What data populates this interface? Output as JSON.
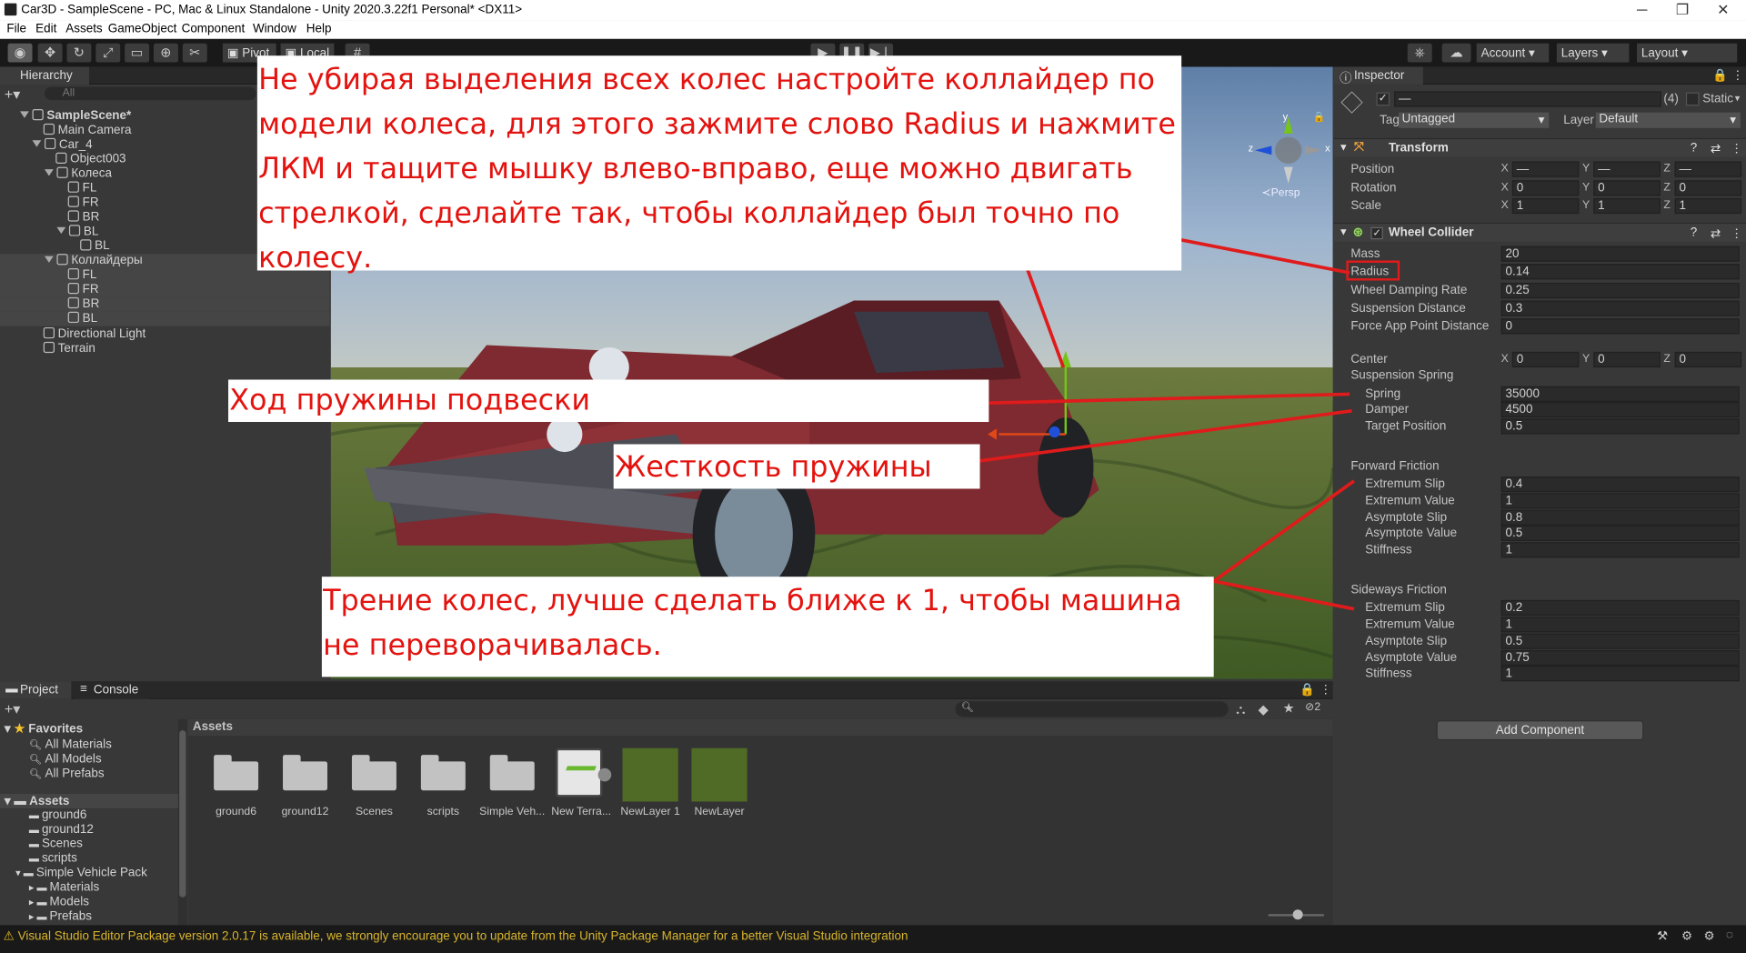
{
  "window": {
    "title": "Car3D - SampleScene - PC, Mac & Linux Standalone - Unity 2020.3.22f1 Personal* <DX11>"
  },
  "menu": [
    "File",
    "Edit",
    "Assets",
    "GameObject",
    "Component",
    "Window",
    "Help"
  ],
  "toolbar": {
    "pivot": "Pivot",
    "local": "Local",
    "account": "Account",
    "layers": "Layers",
    "layout": "Layout"
  },
  "hierarchy": {
    "tab": "Hierarchy",
    "search_placeholder": "All",
    "items": [
      {
        "label": "SampleScene*",
        "depth": 0
      },
      {
        "label": "Main Camera",
        "depth": 1
      },
      {
        "label": "Car_4",
        "depth": 1
      },
      {
        "label": "Object003",
        "depth": 2
      },
      {
        "label": "Колеса",
        "depth": 2
      },
      {
        "label": "FL",
        "depth": 3
      },
      {
        "label": "FR",
        "depth": 3
      },
      {
        "label": "BR",
        "depth": 3
      },
      {
        "label": "BL",
        "depth": 3
      },
      {
        "label": "BL",
        "depth": 4
      },
      {
        "label": "Коллайдеры",
        "depth": 2
      },
      {
        "label": "FL",
        "depth": 3
      },
      {
        "label": "FR",
        "depth": 3
      },
      {
        "label": "BR",
        "depth": 3
      },
      {
        "label": "BL",
        "depth": 3
      },
      {
        "label": "Directional Light",
        "depth": 1
      },
      {
        "label": "Terrain",
        "depth": 1
      }
    ]
  },
  "scene": {
    "persp": "≺Persp",
    "gizmo_y": "y",
    "gizmo_x": "x",
    "gizmo_z": "z"
  },
  "inspector": {
    "tab": "Inspector",
    "name_value": "—",
    "count": "(4)",
    "static": "Static",
    "tag_label": "Tag",
    "tag_value": "Untagged",
    "layer_label": "Layer",
    "layer_value": "Default",
    "transform": {
      "title": "Transform",
      "position": {
        "label": "Position",
        "x": "—",
        "y": "—",
        "z": "—"
      },
      "rotation": {
        "label": "Rotation",
        "x": "0",
        "y": "0",
        "z": "0"
      },
      "scale": {
        "label": "Scale",
        "x": "1",
        "y": "1",
        "z": "1"
      }
    },
    "wheel_collider": {
      "title": "Wheel Collider",
      "mass": {
        "label": "Mass",
        "value": "20"
      },
      "radius": {
        "label": "Radius",
        "value": "0.14"
      },
      "damping": {
        "label": "Wheel Damping Rate",
        "value": "0.25"
      },
      "susp_distance": {
        "label": "Suspension Distance",
        "value": "0.3"
      },
      "force_app": {
        "label": "Force App Point Distance",
        "value": "0"
      },
      "center": {
        "label": "Center",
        "x": "0",
        "y": "0",
        "z": "0"
      },
      "susp_spring": "Suspension Spring",
      "spring": {
        "label": "Spring",
        "value": "35000"
      },
      "damper": {
        "label": "Damper",
        "value": "4500"
      },
      "target": {
        "label": "Target Position",
        "value": "0.5"
      },
      "forward": "Forward Friction",
      "f_ext_slip": {
        "label": "Extremum Slip",
        "value": "0.4"
      },
      "f_ext_val": {
        "label": "Extremum Value",
        "value": "1"
      },
      "f_asy_slip": {
        "label": "Asymptote Slip",
        "value": "0.8"
      },
      "f_asy_val": {
        "label": "Asymptote Value",
        "value": "0.5"
      },
      "f_stiff": {
        "label": "Stiffness",
        "value": "1"
      },
      "sideways": "Sideways Friction",
      "s_ext_slip": {
        "label": "Extremum Slip",
        "value": "0.2"
      },
      "s_ext_val": {
        "label": "Extremum Value",
        "value": "1"
      },
      "s_asy_slip": {
        "label": "Asymptote Slip",
        "value": "0.5"
      },
      "s_asy_val": {
        "label": "Asymptote Value",
        "value": "0.75"
      },
      "s_stiff": {
        "label": "Stiffness",
        "value": "1"
      }
    },
    "add_component": "Add Component"
  },
  "project": {
    "tab_project": "Project",
    "tab_console": "Console",
    "favorites": "Favorites",
    "fav_items": [
      "All Materials",
      "All Models",
      "All Prefabs"
    ],
    "assets_root": "Assets",
    "tree": [
      "ground6",
      "ground12",
      "Scenes",
      "scripts",
      "Simple Vehicle Pack",
      "Materials",
      "Models",
      "Prefabs"
    ],
    "breadcrumb": "Assets",
    "hidden_count": "2",
    "grid": [
      "ground6",
      "ground12",
      "Scenes",
      "scripts",
      "Simple Veh...",
      "New Terra...",
      "NewLayer 1",
      "NewLayer"
    ]
  },
  "status": {
    "message": "Visual Studio Editor Package version 2.0.17 is available, we strongly encourage you to update from the Unity Package Manager for a better Visual Studio integration"
  },
  "annotations": {
    "a1": "Не убирая выделения всех колес настройте коллайдер по модели колеса, для этого зажмите слово Radius и нажмите ЛКМ и тащите мышку влево-вправо, еще можно двигать стрелкой, сделайте так, чтобы коллайдер был точно по колесу.",
    "a2": "Ход пружины подвески",
    "a3": "Жесткость пружины",
    "a4": "Трение колес, лучше сделать ближе к 1, чтобы машина не переворачивалась."
  },
  "colors": {
    "annotation": "#e3130f",
    "accent": "#2c5d87",
    "warning": "#d9b52c"
  }
}
